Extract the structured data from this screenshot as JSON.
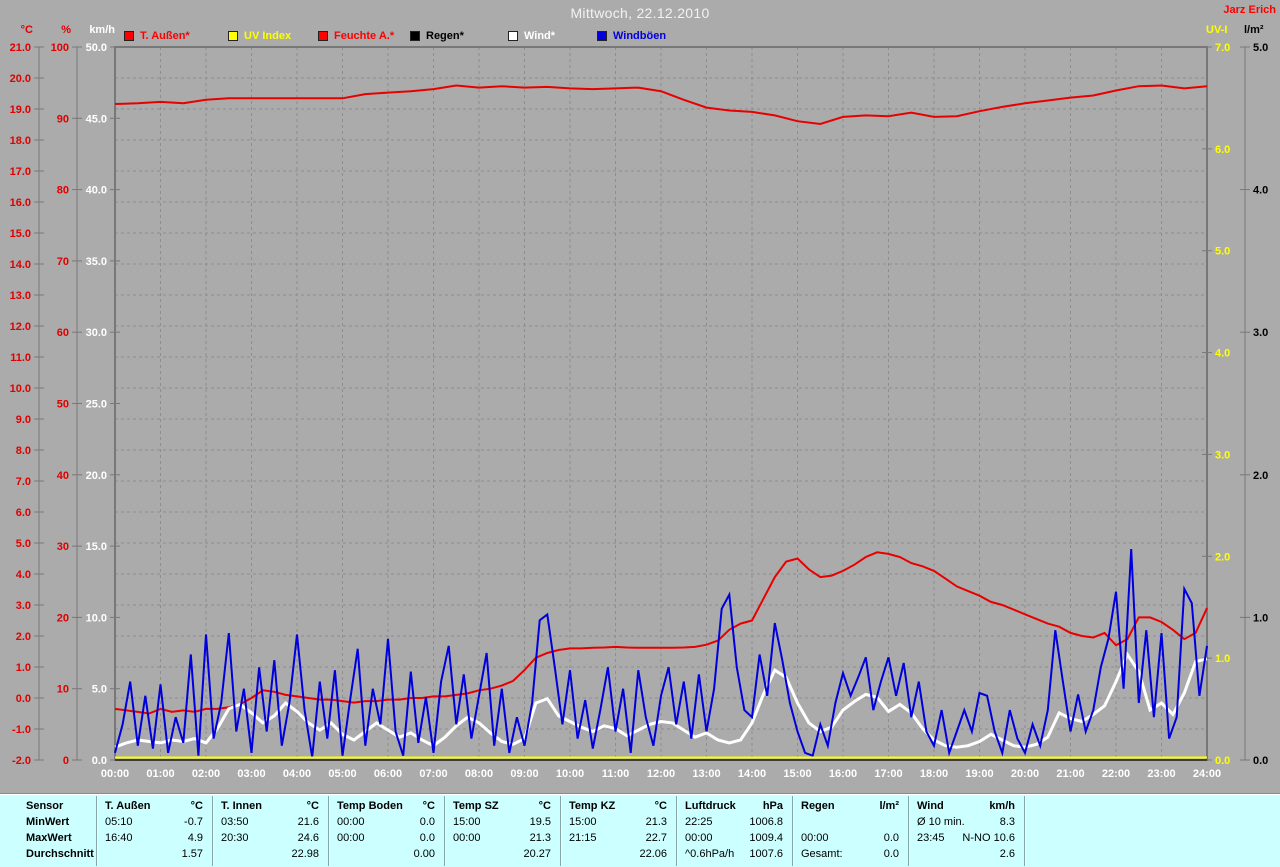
{
  "header": {
    "title": "Mittwoch, 22.12.2010",
    "author": "Jarz Erich"
  },
  "legend": [
    {
      "label": "T. Außen*",
      "color": "#ff0000",
      "text_color": "#ff0000"
    },
    {
      "label": "UV Index",
      "color": "#ffff00",
      "text_color": "#ffff00"
    },
    {
      "label": "Feuchte A.*",
      "color": "#ff0000",
      "text_color": "#ff0000"
    },
    {
      "label": "Regen*",
      "color": "#000000",
      "text_color": "#000000"
    },
    {
      "label": "Wind*",
      "color": "#ffffff",
      "text_color": "#ffffff"
    },
    {
      "label": "Windböen",
      "color": "#0000e0",
      "text_color": "#0000e0"
    }
  ],
  "chart_data": {
    "type": "line",
    "title": "Mittwoch, 22.12.2010",
    "grid": true,
    "x_hours": 24,
    "x_labels": [
      "00:00",
      "01:00",
      "02:00",
      "03:00",
      "04:00",
      "05:00",
      "06:00",
      "07:00",
      "08:00",
      "09:00",
      "10:00",
      "11:00",
      "12:00",
      "13:00",
      "14:00",
      "15:00",
      "16:00",
      "17:00",
      "18:00",
      "19:00",
      "20:00",
      "21:00",
      "22:00",
      "23:00",
      "24:00"
    ],
    "axes": {
      "left": [
        {
          "id": "temp",
          "unit": "°C",
          "min": -2,
          "max": 21,
          "step": 1,
          "decimals": 1,
          "color": "#e00000"
        },
        {
          "id": "hum",
          "unit": "%",
          "min": 0,
          "max": 100,
          "step": 10,
          "decimals": 0,
          "color": "#e00000"
        },
        {
          "id": "wind",
          "unit": "km/h",
          "min": 0,
          "max": 50,
          "step": 5,
          "decimals": 1,
          "color": "#ffffff"
        }
      ],
      "right": [
        {
          "id": "uv",
          "unit": "UV-I",
          "min": 0,
          "max": 7,
          "step": 1,
          "decimals": 1,
          "color": "#ffff00"
        },
        {
          "id": "rain",
          "unit": "l/m²",
          "min": 0,
          "max": 5,
          "step": 1,
          "decimals": 1,
          "color": "#000000"
        }
      ]
    },
    "series": [
      {
        "id": "rain",
        "name": "Regen*",
        "axis": "rain",
        "color": "#000000",
        "width": 1,
        "step_min": 720,
        "values": [
          0,
          0,
          0
        ]
      },
      {
        "id": "temp",
        "name": "T. Außen*",
        "axis": "temp",
        "color": "#e80000",
        "width": 2,
        "step_min": 15,
        "values": [
          -0.35,
          -0.4,
          -0.45,
          -0.5,
          -0.35,
          -0.45,
          -0.4,
          -0.45,
          -0.35,
          -0.35,
          -0.3,
          -0.2,
          0.0,
          0.25,
          0.2,
          0.1,
          0.05,
          0.0,
          -0.05,
          -0.05,
          -0.1,
          -0.15,
          -0.1,
          -0.1,
          -0.05,
          -0.05,
          0.0,
          0.0,
          0.05,
          0.05,
          0.1,
          0.15,
          0.25,
          0.3,
          0.4,
          0.55,
          0.9,
          1.3,
          1.45,
          1.55,
          1.6,
          1.6,
          1.62,
          1.63,
          1.65,
          1.63,
          1.62,
          1.62,
          1.62,
          1.62,
          1.63,
          1.65,
          1.72,
          1.85,
          2.2,
          2.4,
          2.5,
          3.2,
          3.9,
          4.4,
          4.5,
          4.15,
          3.9,
          3.95,
          4.1,
          4.3,
          4.55,
          4.7,
          4.65,
          4.55,
          4.35,
          4.25,
          4.1,
          3.85,
          3.6,
          3.45,
          3.3,
          3.1,
          3.0,
          2.85,
          2.7,
          2.55,
          2.4,
          2.3,
          2.1,
          2.0,
          1.95,
          2.1,
          1.7,
          1.9,
          2.6,
          2.6,
          2.45,
          2.2,
          1.9,
          2.1,
          2.9
        ]
      },
      {
        "id": "hum",
        "name": "Feuchte A.*",
        "axis": "hum",
        "color": "#e80000",
        "width": 2,
        "step_min": 30,
        "values": [
          92.0,
          92.1,
          92.3,
          92.1,
          92.6,
          92.8,
          92.8,
          92.8,
          92.8,
          92.8,
          92.8,
          93.4,
          93.6,
          93.8,
          94.1,
          94.6,
          94.3,
          94.5,
          94.3,
          94.4,
          94.2,
          94.1,
          94.2,
          94.3,
          93.8,
          92.6,
          91.5,
          91.1,
          90.9,
          90.4,
          89.6,
          89.2,
          90.2,
          90.4,
          90.3,
          90.8,
          90.2,
          90.3,
          91.0,
          91.6,
          92.1,
          92.5,
          92.9,
          93.2,
          93.9,
          94.5,
          94.6,
          94.2,
          94.5
        ]
      },
      {
        "id": "wind",
        "name": "Wind*",
        "axis": "wind",
        "color": "#ffffff",
        "width": 3,
        "step_min": 15,
        "values": [
          0.9,
          1.2,
          1.4,
          1.3,
          1.2,
          1.4,
          1.3,
          1.5,
          1.2,
          2.2,
          3.6,
          3.9,
          3.3,
          2.6,
          3.1,
          4.0,
          3.4,
          2.6,
          2.1,
          2.6,
          1.8,
          1.4,
          2.0,
          2.6,
          2.1,
          1.6,
          1.9,
          1.4,
          1.0,
          1.6,
          2.4,
          3.0,
          2.6,
          1.9,
          1.3,
          1.1,
          1.5,
          4.0,
          4.3,
          3.1,
          2.7,
          2.3,
          2.0,
          2.4,
          2.2,
          1.7,
          2.1,
          2.5,
          2.7,
          2.6,
          2.1,
          1.6,
          1.9,
          1.4,
          1.2,
          1.4,
          2.6,
          4.6,
          6.3,
          5.8,
          4.0,
          2.6,
          2.0,
          2.3,
          3.5,
          4.1,
          4.6,
          4.4,
          3.4,
          3.9,
          3.3,
          2.2,
          1.4,
          1.0,
          0.9,
          1.0,
          1.3,
          1.8,
          1.4,
          1.0,
          0.9,
          1.1,
          1.6,
          3.3,
          2.9,
          2.7,
          3.2,
          3.8,
          5.5,
          7.4,
          6.2,
          3.5,
          4.0,
          3.2,
          4.7,
          6.9,
          7.1
        ]
      },
      {
        "id": "gusts",
        "name": "Windböen",
        "axis": "wind",
        "color": "#0000dc",
        "width": 2,
        "step_min": 10,
        "values": [
          0.5,
          2.5,
          5.5,
          1.0,
          4.5,
          0.8,
          5.3,
          0.5,
          3.0,
          1.2,
          7.4,
          0.3,
          8.8,
          1.5,
          4.0,
          8.9,
          2.0,
          5.0,
          0.5,
          6.5,
          2.0,
          7.0,
          1.0,
          4.0,
          8.8,
          3.5,
          0.2,
          5.5,
          1.5,
          6.3,
          0.3,
          4.2,
          7.8,
          1.0,
          5.0,
          2.5,
          8.5,
          2.0,
          0.3,
          6.2,
          1.2,
          4.4,
          0.5,
          5.5,
          8.0,
          2.5,
          6.0,
          1.5,
          4.5,
          7.5,
          1.0,
          5.0,
          0.5,
          3.0,
          1.0,
          4.0,
          9.8,
          10.2,
          6.5,
          2.5,
          6.3,
          1.5,
          4.2,
          0.8,
          3.5,
          6.5,
          2.0,
          5.0,
          0.5,
          6.3,
          3.0,
          1.0,
          4.5,
          6.5,
          2.5,
          5.5,
          1.5,
          6.0,
          2.0,
          5.0,
          10.6,
          11.6,
          6.5,
          3.5,
          3.0,
          7.4,
          4.5,
          9.6,
          7.0,
          4.0,
          2.0,
          0.5,
          0.3,
          2.5,
          1.0,
          4.0,
          6.1,
          4.5,
          5.8,
          7.2,
          3.5,
          5.5,
          7.2,
          4.5,
          6.8,
          3.0,
          5.5,
          2.0,
          1.0,
          3.5,
          0.5,
          2.0,
          3.5,
          2.0,
          4.7,
          4.5,
          2.0,
          0.5,
          3.5,
          1.5,
          0.5,
          2.5,
          1.0,
          3.5,
          9.1,
          5.5,
          2.0,
          4.6,
          2.0,
          3.5,
          6.5,
          8.5,
          11.8,
          5.0,
          14.8,
          4.0,
          9.1,
          3.0,
          8.9,
          1.5,
          3.0,
          12.0,
          11.0,
          4.5,
          8.0
        ]
      },
      {
        "id": "uv",
        "name": "UV Index",
        "axis": "uv",
        "color": "#ffff00",
        "width": 2,
        "step_min": 720,
        "values": [
          0,
          0,
          0
        ]
      }
    ]
  },
  "table": {
    "row_headers": [
      "Sensor",
      "MinWert",
      "MaxWert",
      "Durchschnitt"
    ],
    "columns": [
      {
        "name": "T. Außen",
        "unit": "°C",
        "min": [
          "05:10",
          "-0.7"
        ],
        "max": [
          "16:40",
          "4.9"
        ],
        "avg": [
          "",
          "1.57"
        ]
      },
      {
        "name": "T. Innen",
        "unit": "°C",
        "min": [
          "03:50",
          "21.6"
        ],
        "max": [
          "20:30",
          "24.6"
        ],
        "avg": [
          "",
          "22.98"
        ]
      },
      {
        "name": "Temp Boden",
        "unit": "°C",
        "min": [
          "00:00",
          "0.0"
        ],
        "max": [
          "00:00",
          "0.0"
        ],
        "avg": [
          "",
          "0.00"
        ]
      },
      {
        "name": "Temp SZ",
        "unit": "°C",
        "min": [
          "15:00",
          "19.5"
        ],
        "max": [
          "00:00",
          "21.3"
        ],
        "avg": [
          "",
          "20.27"
        ]
      },
      {
        "name": "Temp KZ",
        "unit": "°C",
        "min": [
          "15:00",
          "21.3"
        ],
        "max": [
          "21:15",
          "22.7"
        ],
        "avg": [
          "",
          "22.06"
        ]
      },
      {
        "name": "Luftdruck",
        "unit": "hPa",
        "min": [
          "22:25",
          "1006.8"
        ],
        "max": [
          "00:00",
          "1009.4"
        ],
        "avg": [
          "^0.6hPa/h",
          "1007.6"
        ]
      },
      {
        "name": "Regen",
        "unit": "l/m²",
        "min": [
          "",
          ""
        ],
        "max": [
          "00:00",
          "0.0"
        ],
        "avg": [
          "Gesamt:",
          "0.0"
        ]
      },
      {
        "name": "Wind",
        "unit": "km/h",
        "min": [
          "Ø 10 min.",
          "8.3"
        ],
        "max": [
          "23:45",
          "N-NO 10.6"
        ],
        "avg": [
          "",
          "2.6"
        ]
      }
    ]
  }
}
